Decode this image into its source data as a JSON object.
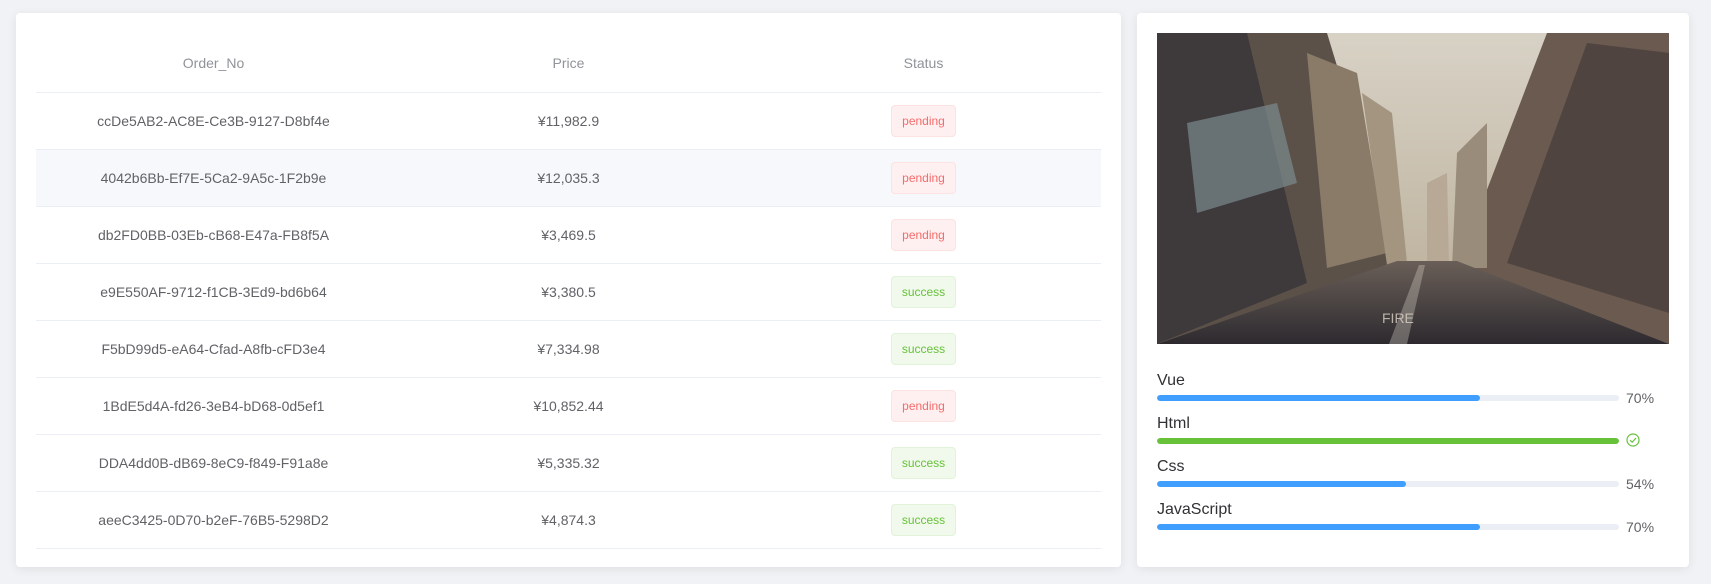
{
  "orders": {
    "headers": {
      "order_no": "Order_No",
      "price": "Price",
      "status": "Status"
    },
    "rows": [
      {
        "order_no": "ccDe5AB2-AC8E-Ce3B-9127-D8bf4e",
        "price": "¥11,982.9",
        "status": "pending"
      },
      {
        "order_no": "4042b6Bb-Ef7E-5Ca2-9A5c-1F2b9e",
        "price": "¥12,035.3",
        "status": "pending"
      },
      {
        "order_no": "db2FD0BB-03Eb-cB68-E47a-FB8f5A",
        "price": "¥3,469.5",
        "status": "pending"
      },
      {
        "order_no": "e9E550AF-9712-f1CB-3Ed9-bd6b64",
        "price": "¥3,380.5",
        "status": "success"
      },
      {
        "order_no": "F5bD99d5-eA64-Cfad-A8fb-cFD3e4",
        "price": "¥7,334.98",
        "status": "success"
      },
      {
        "order_no": "1BdE5d4A-fd26-3eB4-bD68-0d5ef1",
        "price": "¥10,852.44",
        "status": "pending"
      },
      {
        "order_no": "DDA4dd0B-dB69-8eC9-f849-F91a8e",
        "price": "¥5,335.32",
        "status": "success"
      },
      {
        "order_no": "aeeC3425-0D70-b2eF-76B5-5298D2",
        "price": "¥4,874.3",
        "status": "success"
      }
    ]
  },
  "image": {
    "icon": "city-street-photo"
  },
  "skills": [
    {
      "label": "Vue",
      "percent": 70,
      "text": "70%",
      "color": "#409eff"
    },
    {
      "label": "Html",
      "percent": 100,
      "text": "",
      "color": "#67c23a",
      "icon": "check-circle-icon"
    },
    {
      "label": "Css",
      "percent": 54,
      "text": "54%",
      "color": "#409eff"
    },
    {
      "label": "JavaScript",
      "percent": 70,
      "text": "70%",
      "color": "#409eff"
    }
  ],
  "colors": {
    "pending": "#f56c6c",
    "success": "#67c23a",
    "accent": "#409eff"
  }
}
